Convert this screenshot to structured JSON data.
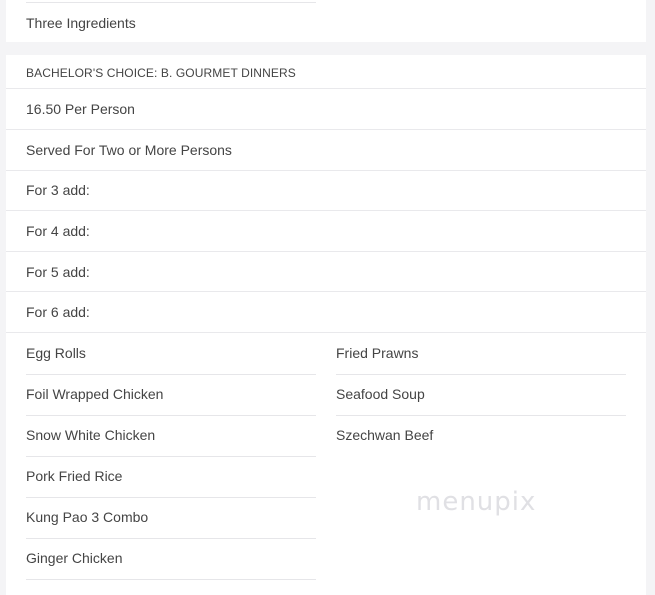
{
  "top_section": {
    "last_item": "Three Ingredients"
  },
  "section": {
    "title": "BACHELOR'S CHOICE: B. GOURMET DINNERS",
    "rows": [
      "16.50 Per Person",
      "Served For Two or More Persons",
      "For 3 add:",
      "For 4 add:",
      "For 5 add:",
      "For 6 add:"
    ],
    "left_items": [
      "Egg Rolls",
      "Foil Wrapped Chicken",
      "Snow White Chicken",
      "Pork Fried Rice",
      "Kung Pao 3 Combo",
      "Ginger Chicken"
    ],
    "right_items": [
      "Fried Prawns",
      "Seafood Soup",
      "Szechwan Beef"
    ]
  },
  "watermark": "menupix"
}
